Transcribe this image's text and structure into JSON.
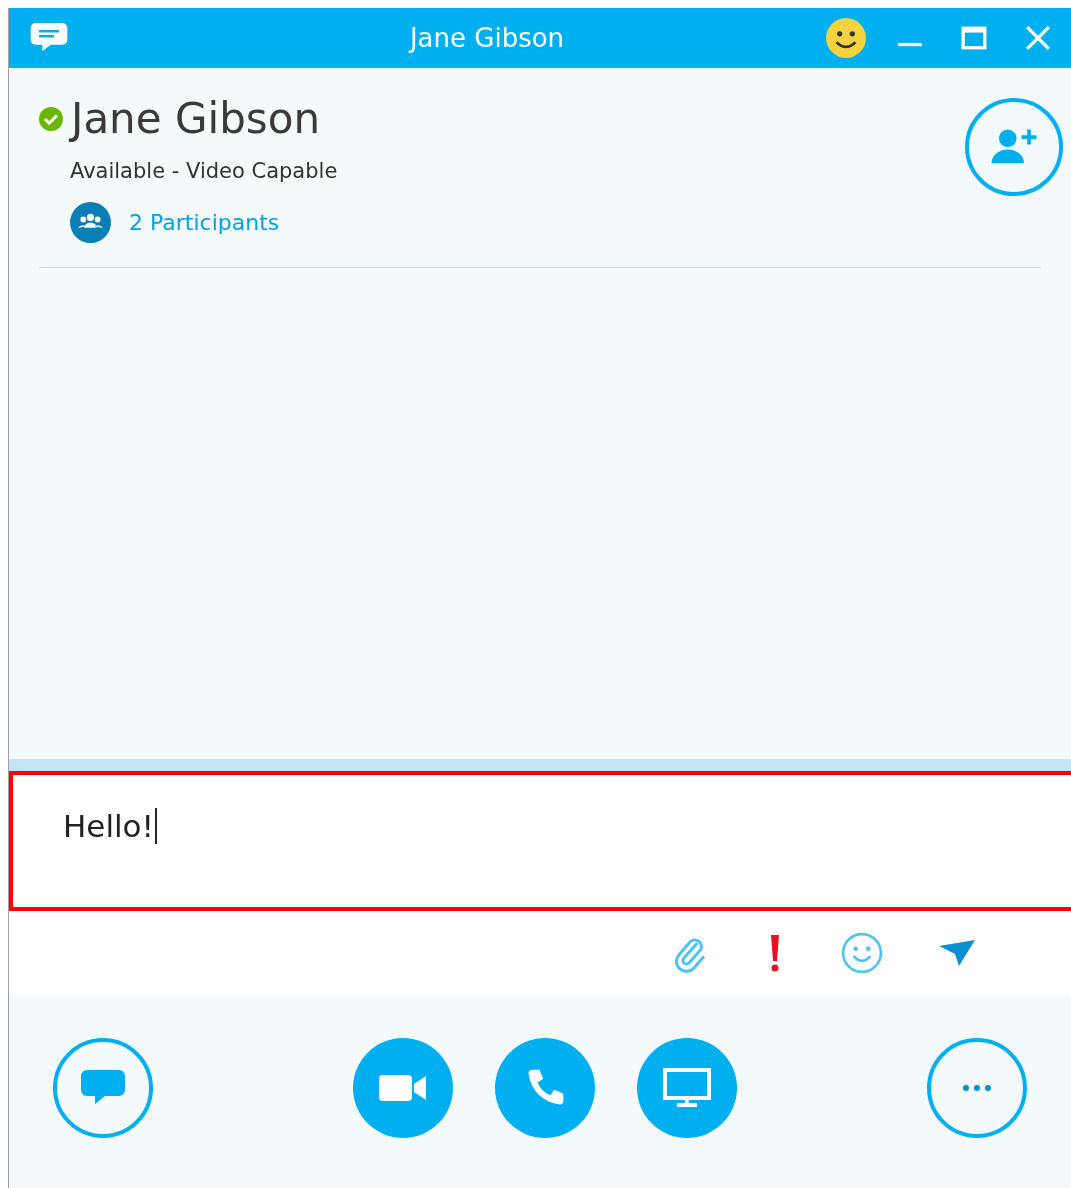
{
  "window": {
    "title": "Jane Gibson"
  },
  "contact": {
    "name": "Jane Gibson",
    "color": "#6bb700",
    "status": "Available - Video Capable",
    "participants": "2 Participants"
  },
  "compose": {
    "value": "Hello!",
    "highlighted": true
  }
}
